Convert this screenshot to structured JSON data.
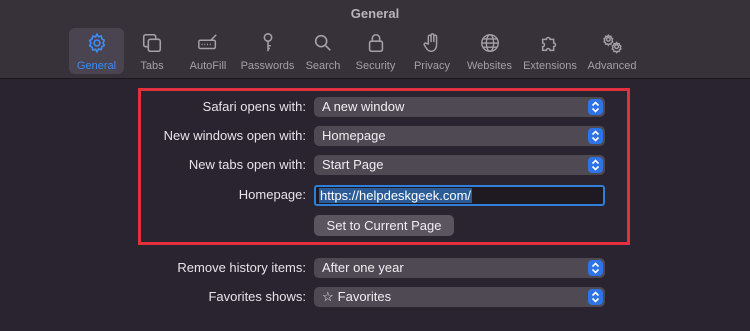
{
  "window": {
    "title": "General"
  },
  "tabs": [
    {
      "label": "General",
      "icon": "gear-icon",
      "active": true
    },
    {
      "label": "Tabs",
      "icon": "tabs-icon"
    },
    {
      "label": "AutoFill",
      "icon": "autofill-icon"
    },
    {
      "label": "Passwords",
      "icon": "key-icon"
    },
    {
      "label": "Search",
      "icon": "search-icon"
    },
    {
      "label": "Security",
      "icon": "lock-icon"
    },
    {
      "label": "Privacy",
      "icon": "hand-icon"
    },
    {
      "label": "Websites",
      "icon": "globe-icon"
    },
    {
      "label": "Extensions",
      "icon": "puzzle-icon"
    },
    {
      "label": "Advanced",
      "icon": "gears-icon"
    }
  ],
  "settings": {
    "safari_opens": {
      "label": "Safari opens with:",
      "value": "A new window"
    },
    "new_windows": {
      "label": "New windows open with:",
      "value": "Homepage"
    },
    "new_tabs": {
      "label": "New tabs open with:",
      "value": "Start Page"
    },
    "homepage": {
      "label": "Homepage:",
      "value": "https://helpdeskgeek.com/"
    },
    "set_current_button": "Set to Current Page",
    "remove_history": {
      "label": "Remove history items:",
      "value": "After one year"
    },
    "favorites": {
      "label": "Favorites shows:",
      "value": "Favorites",
      "icon": "star-icon"
    }
  },
  "colors": {
    "accent": "#2e74e6",
    "active_tab_label": "#3d8bf5",
    "highlight_border": "#e3303d",
    "background": "#2a2430"
  }
}
